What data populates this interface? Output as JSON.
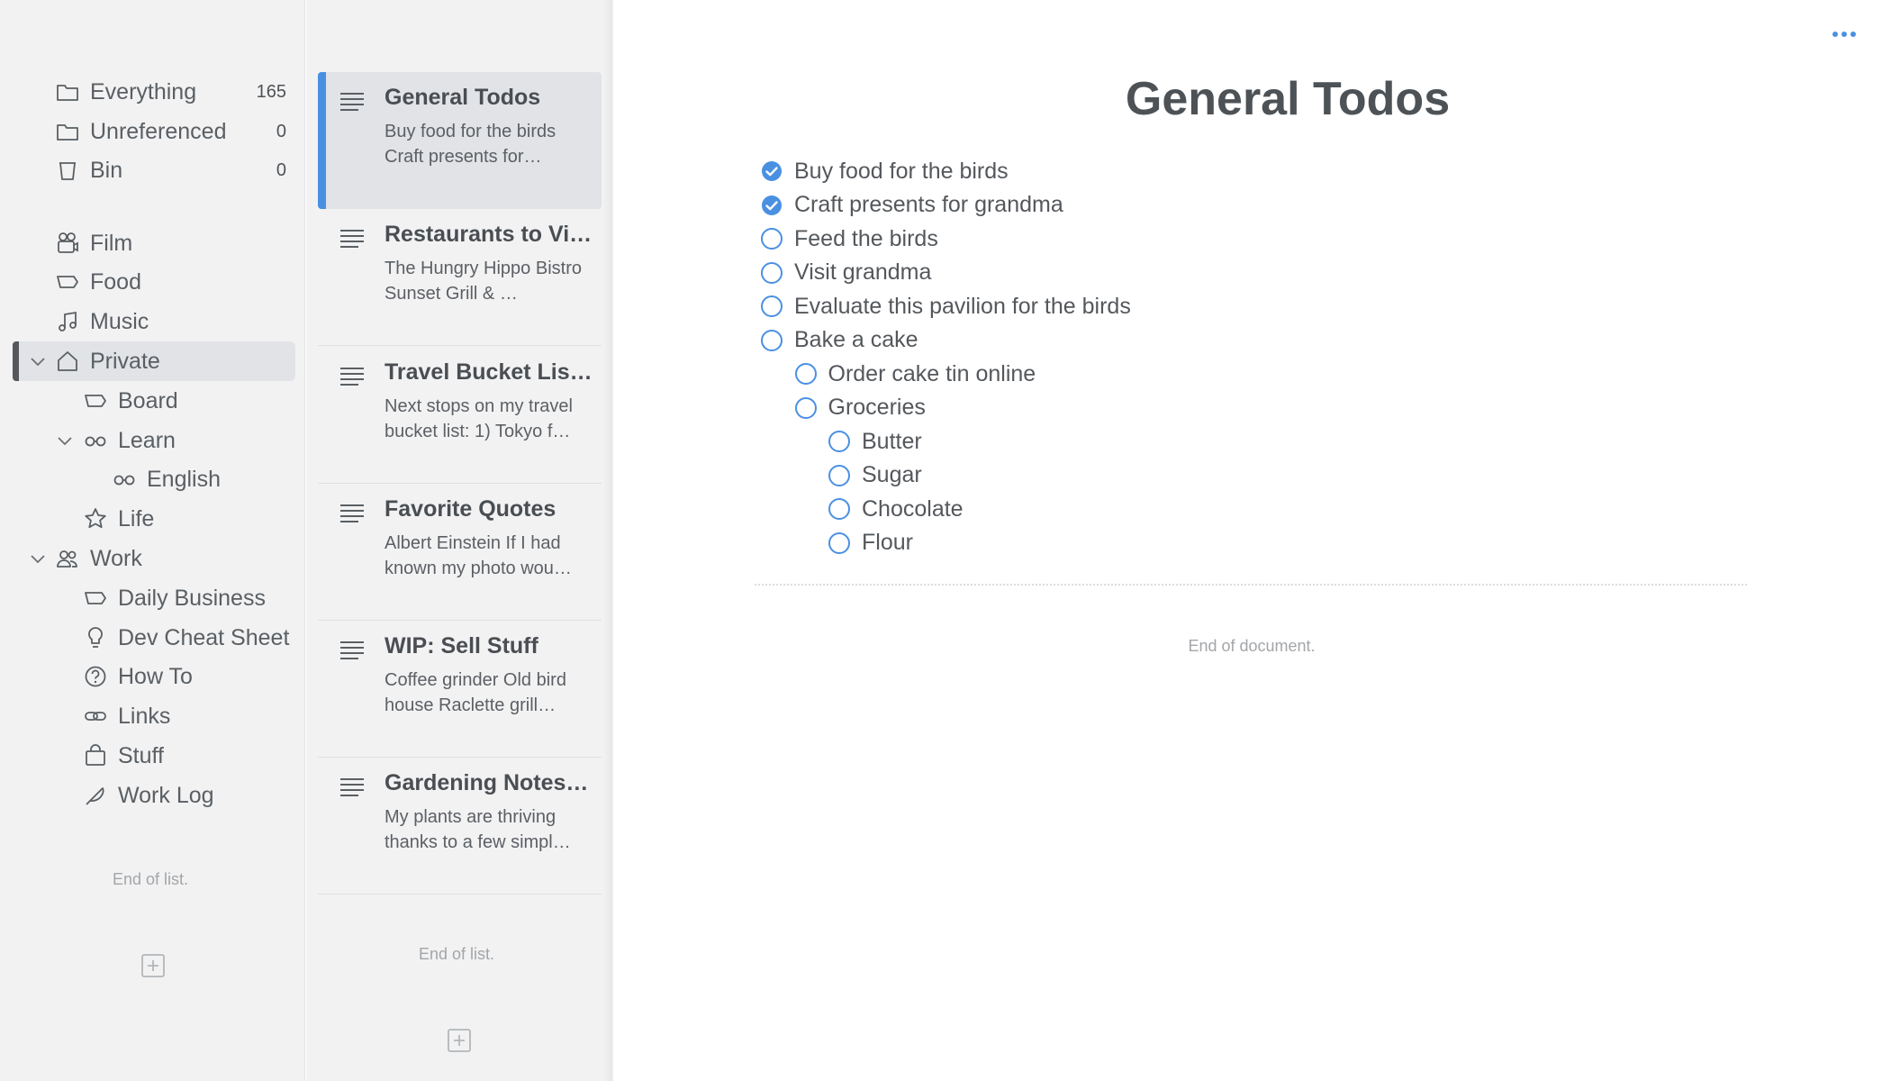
{
  "sidebar": {
    "system": [
      {
        "label": "Everything",
        "count": "165",
        "icon": "folder-icon"
      },
      {
        "label": "Unreferenced",
        "count": "0",
        "icon": "folder-icon"
      },
      {
        "label": "Bin",
        "count": "0",
        "icon": "trash-icon"
      }
    ],
    "tags": [
      {
        "label": "Film",
        "icon": "camera-icon"
      },
      {
        "label": "Food",
        "icon": "tag-icon"
      },
      {
        "label": "Music",
        "icon": "music-note-icon"
      },
      {
        "label": "Private",
        "icon": "home-icon"
      },
      {
        "label": "Board",
        "icon": "tag-icon"
      },
      {
        "label": "Learn",
        "icon": "glasses-icon"
      },
      {
        "label": "English",
        "icon": "glasses-icon"
      },
      {
        "label": "Life",
        "icon": "star-icon"
      },
      {
        "label": "Work",
        "icon": "people-icon"
      },
      {
        "label": "Daily Business",
        "icon": "tag-icon"
      },
      {
        "label": "Dev Cheat Sheet",
        "icon": "lightbulb-icon"
      },
      {
        "label": "How To",
        "icon": "question-icon"
      },
      {
        "label": "Links",
        "icon": "link-icon"
      },
      {
        "label": "Stuff",
        "icon": "bag-icon"
      },
      {
        "label": "Work Log",
        "icon": "feather-icon"
      }
    ],
    "end_text": "End of list."
  },
  "notes": {
    "items": [
      {
        "title": "General Todos",
        "preview": "Buy food for the birds Craft presents for…"
      },
      {
        "title": "Restaurants to Vi…",
        "preview": "The Hungry Hippo Bistro Sunset Grill & …"
      },
      {
        "title": "Travel Bucket Lis…",
        "preview": "Next stops on my travel bucket list: 1) Tokyo f…"
      },
      {
        "title": "Favorite Quotes",
        "preview": "Albert Einstein If I had known my photo wou…"
      },
      {
        "title": "WIP: Sell Stuff",
        "preview": "Coffee grinder Old bird house Raclette grill…"
      },
      {
        "title": "Gardening Notes…",
        "preview": "My plants are thriving thanks to a few simpl…"
      }
    ],
    "end_text": "End of list."
  },
  "document": {
    "title": "General Todos",
    "todos": [
      {
        "text": "Buy food for the birds",
        "checked": true
      },
      {
        "text": "Craft presents for grandma",
        "checked": true
      },
      {
        "text": "Feed the birds",
        "checked": false
      },
      {
        "text": "Visit grandma",
        "checked": false
      },
      {
        "text": "Evaluate this pavilion for the birds",
        "checked": false
      },
      {
        "text": "Bake a cake",
        "checked": false
      },
      {
        "text": "Order cake tin online",
        "checked": false
      },
      {
        "text": "Groceries",
        "checked": false
      },
      {
        "text": "Butter",
        "checked": false
      },
      {
        "text": "Sugar",
        "checked": false
      },
      {
        "text": "Chocolate",
        "checked": false
      },
      {
        "text": "Flour",
        "checked": false
      }
    ],
    "end_text": "End of document."
  },
  "colors": {
    "accent": "#4a90e2",
    "checked_fill": "#4a90e2"
  }
}
